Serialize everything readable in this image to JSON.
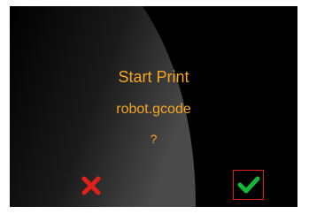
{
  "dialog": {
    "title": "Start Print",
    "filename": "robot.gcode",
    "question": "?"
  },
  "buttons": {
    "cancel_icon": "x-icon",
    "confirm_icon": "checkmark-icon"
  },
  "colors": {
    "background": "#000000",
    "text": "#f5a623",
    "cancel": "#e0201b",
    "confirm": "#16b53c",
    "confirm_border": "#e0201b"
  }
}
